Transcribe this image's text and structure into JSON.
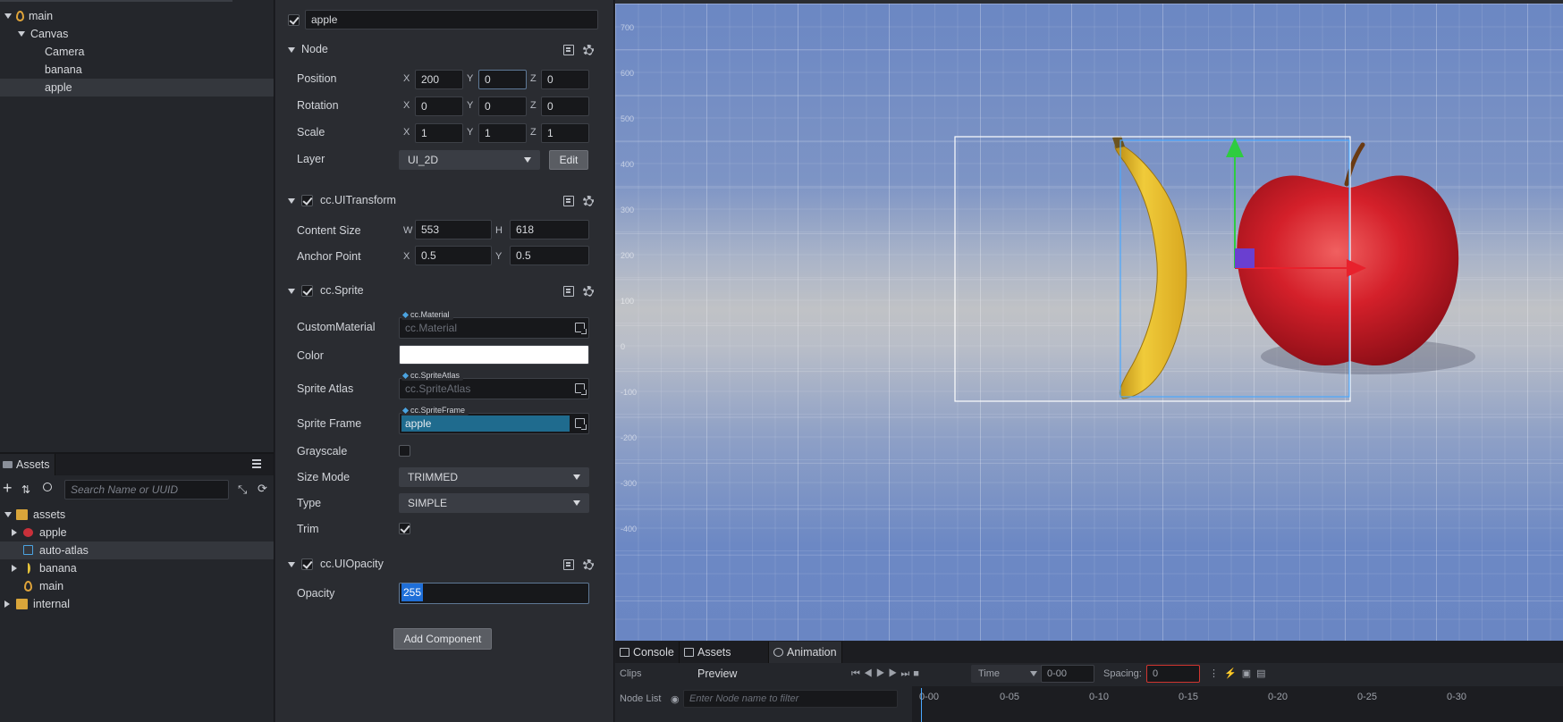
{
  "hierarchy": {
    "items": [
      {
        "label": "main",
        "indent": 0,
        "expanded": true
      },
      {
        "label": "Canvas",
        "indent": 1,
        "expanded": true
      },
      {
        "label": "Camera",
        "indent": 2
      },
      {
        "label": "banana",
        "indent": 2
      },
      {
        "label": "apple",
        "indent": 2,
        "selected": true
      }
    ]
  },
  "assets": {
    "tab_label": "Assets",
    "search_placeholder": "Search Name or UUID",
    "items": [
      {
        "label": "assets"
      },
      {
        "label": "apple"
      },
      {
        "label": "auto-atlas"
      },
      {
        "label": "banana"
      },
      {
        "label": "main"
      },
      {
        "label": "internal"
      }
    ]
  },
  "inspector": {
    "node_name": "apple",
    "node": {
      "title": "Node",
      "position_label": "Position",
      "position": {
        "x": "200",
        "y": "0",
        "z": "0"
      },
      "rotation_label": "Rotation",
      "rotation": {
        "x": "0",
        "y": "0",
        "z": "0"
      },
      "scale_label": "Scale",
      "scale": {
        "x": "1",
        "y": "1",
        "z": "1"
      },
      "layer_label": "Layer",
      "layer_value": "UI_2D",
      "edit_label": "Edit"
    },
    "uitransform": {
      "title": "cc.UITransform",
      "content_size_label": "Content Size",
      "w": "553",
      "h": "618",
      "anchor_label": "Anchor Point",
      "ax": "0.5",
      "ay": "0.5"
    },
    "sprite": {
      "title": "cc.Sprite",
      "custom_material_label": "CustomMaterial",
      "custom_material_tag": "cc.Material",
      "custom_material_value": "cc.Material",
      "color_label": "Color",
      "color_value": "#ffffff",
      "sprite_atlas_label": "Sprite Atlas",
      "sprite_atlas_tag": "cc.SpriteAtlas",
      "sprite_atlas_value": "cc.SpriteAtlas",
      "sprite_frame_label": "Sprite Frame",
      "sprite_frame_tag": "cc.SpriteFrame",
      "sprite_frame_value": "apple",
      "grayscale_label": "Grayscale",
      "size_mode_label": "Size Mode",
      "size_mode_value": "TRIMMED",
      "type_label": "Type",
      "type_value": "SIMPLE",
      "trim_label": "Trim"
    },
    "uiopacity": {
      "title": "cc.UIOpacity",
      "opacity_label": "Opacity",
      "opacity_value": "255"
    },
    "add_component_label": "Add Component",
    "axes": {
      "x": "X",
      "y": "Y",
      "z": "Z",
      "w": "W",
      "h": "H"
    }
  },
  "scene": {
    "ruler_labels": [
      "700",
      "600",
      "500",
      "400",
      "300",
      "200",
      "100",
      "0",
      "-100",
      "-200",
      "-300",
      "-400"
    ]
  },
  "bottom": {
    "tabs": [
      "Console",
      "Assets Preview",
      "Animation"
    ],
    "clips_label": "Clips",
    "time_label": "Time",
    "time_value": "0-00",
    "spacing_label": "Spacing:",
    "spacing_value": "0",
    "node_list_label": "Node List",
    "node_filter_placeholder": "Enter Node name to filter",
    "timeline_ticks": [
      "0-00",
      "0-05",
      "0-10",
      "0-15",
      "0-20",
      "0-25",
      "0-30"
    ]
  }
}
